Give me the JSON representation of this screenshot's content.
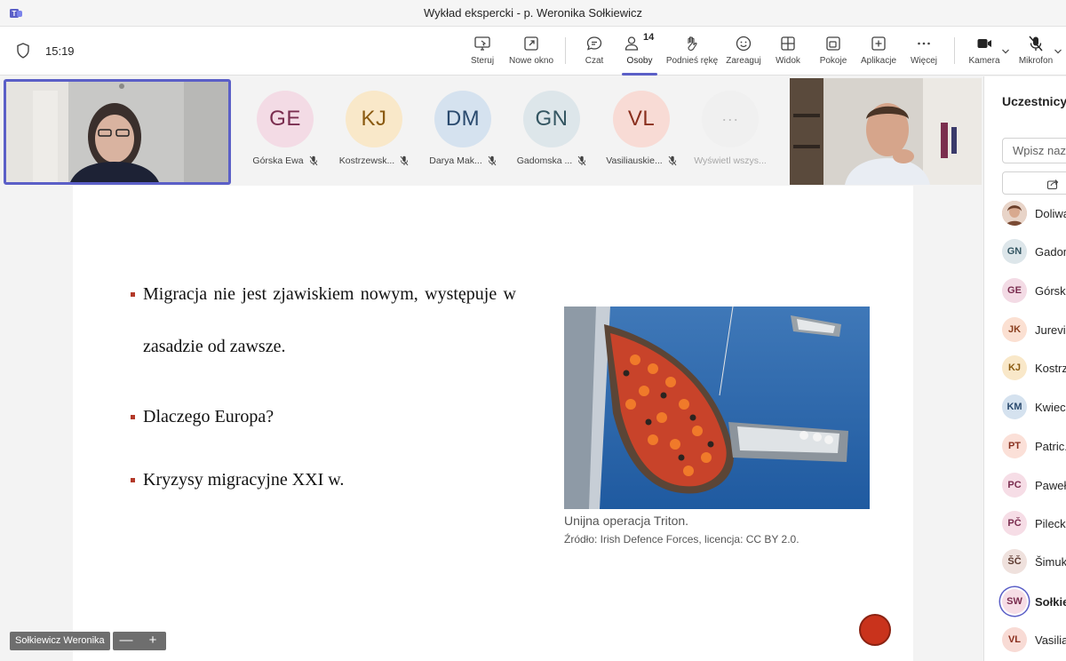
{
  "window": {
    "title": "Wykład ekspercki - p. Weronika Sołkiewicz"
  },
  "meeting": {
    "time": "15:19"
  },
  "toolbar": {
    "steruj": "Steruj",
    "nowe_okno": "Nowe okno",
    "czat": "Czat",
    "osoby": "Osoby",
    "osoby_count": "14",
    "podnies_reke": "Podnieś rękę",
    "zareaguj": "Zareaguj",
    "widok": "Widok",
    "pokoje": "Pokoje",
    "aplikacje": "Aplikacje",
    "wiecej": "Więcej",
    "kamera": "Kamera",
    "mikrofon": "Mikrofon"
  },
  "gallery": [
    {
      "initials": "GE",
      "name": "Górska Ewa",
      "bg": "#f3dbe5",
      "fg": "#7a2d4f"
    },
    {
      "initials": "KJ",
      "name": "Kostrzewsk...",
      "bg": "#f9e8c9",
      "fg": "#8a5a10"
    },
    {
      "initials": "DM",
      "name": "Darya Mak...",
      "bg": "#d5e2ef",
      "fg": "#2a4a6e"
    },
    {
      "initials": "GN",
      "name": "Gadomska ...",
      "bg": "#dde6ea",
      "fg": "#345662"
    },
    {
      "initials": "VL",
      "name": "Vasiliauskie...",
      "bg": "#f8dbd5",
      "fg": "#8a2f1e"
    },
    {
      "initials": "···",
      "name": "Wyświetl wszys...",
      "bg": "#f0f0f0",
      "fg": "#bdbdbd"
    }
  ],
  "slide": {
    "bullet1_line1": "Migracja nie jest zjawiskiem nowym, występuje w",
    "bullet1_line2": "zasadzie od zawsze.",
    "bullet2": "Dlaczego Europa?",
    "bullet3": "Kryzysy migracyjne XXI w.",
    "caption": "Unijna operacja Triton.",
    "source": "Źródło: Irish Defence Forces, licencja: CC BY 2.0."
  },
  "self_view": {
    "name": "Sołkiewicz Weronika",
    "zoom_out": "—",
    "zoom_in": "+"
  },
  "panel": {
    "title": "Uczestnicy",
    "search_placeholder": "Wpisz nazw",
    "participants": [
      {
        "initials": "",
        "name": "Doliwa",
        "bg": "#d9b3a1",
        "fg": "#ffffff"
      },
      {
        "initials": "GN",
        "name": "Gadom",
        "bg": "#dde6ea",
        "fg": "#345662"
      },
      {
        "initials": "GE",
        "name": "Górska",
        "bg": "#f3dbe5",
        "fg": "#7a2d4f"
      },
      {
        "initials": "JK",
        "name": "Jurevič",
        "bg": "#fbe0d2",
        "fg": "#8a3f1e"
      },
      {
        "initials": "KJ",
        "name": "Kostrz",
        "bg": "#f9e8c9",
        "fg": "#8a5a10"
      },
      {
        "initials": "KM",
        "name": "Kwieci",
        "bg": "#d5e2ef",
        "fg": "#2a4a6e"
      },
      {
        "initials": "PT",
        "name": "Patric.",
        "bg": "#fbe0d8",
        "fg": "#8a3322"
      },
      {
        "initials": "PC",
        "name": "Paweł",
        "bg": "#f6dde6",
        "fg": "#7a2d4f"
      },
      {
        "initials": "PČ",
        "name": "Pilecki",
        "bg": "#f6dde6",
        "fg": "#7a2d4f"
      },
      {
        "initials": "ŠČ",
        "name": "Šimuk",
        "bg": "#efe1dd",
        "fg": "#5d3a30"
      },
      {
        "initials": "SW",
        "name": "Sołkie",
        "bg": "#f6dde6",
        "fg": "#7a2d4f"
      },
      {
        "initials": "VL",
        "name": "Vasilia",
        "bg": "#f8dbd5",
        "fg": "#8a2f1e"
      }
    ]
  },
  "colors": {
    "accent": "#5b5fc7",
    "bullet": "#b33a2a",
    "record": "#c9331c"
  }
}
